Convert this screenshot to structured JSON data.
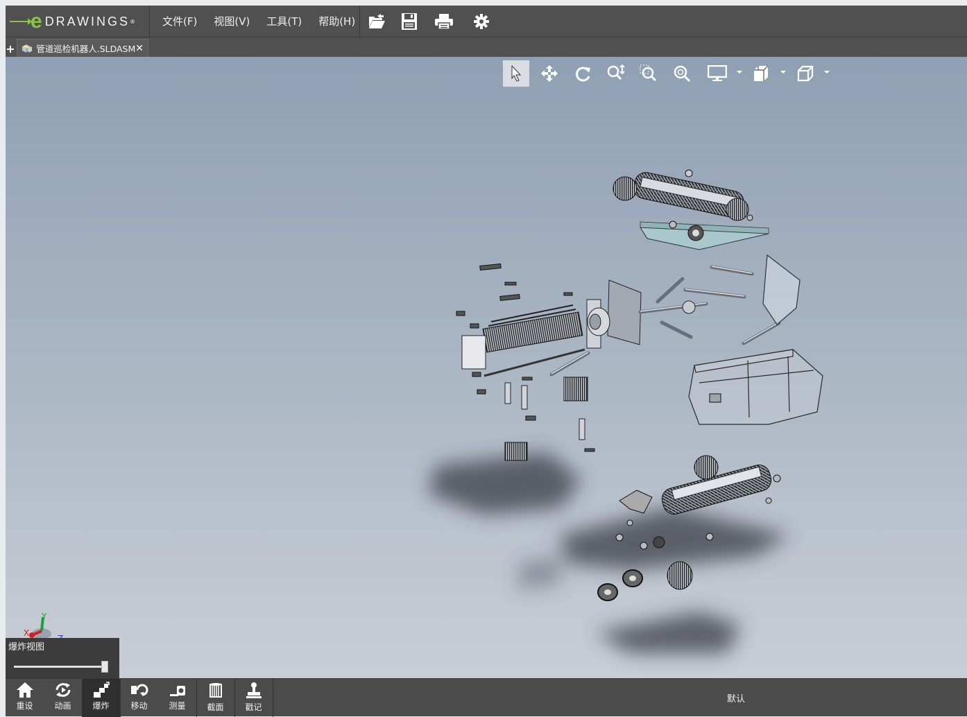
{
  "app": {
    "logo_text": "DRAWINGS",
    "logo_reg": "®"
  },
  "menu": {
    "items": [
      "文件(F)",
      "视图(V)",
      "工具(T)",
      "帮助(H)"
    ]
  },
  "toolbar": {
    "icons": [
      "open-icon",
      "save-icon",
      "print-icon",
      "settings-icon"
    ]
  },
  "tabs": {
    "add_label": "+",
    "documents": [
      {
        "label": "管道巡检机器人.SLDASM",
        "close": "✕"
      }
    ]
  },
  "view_tools": {
    "icons": [
      "select-icon",
      "pan-icon",
      "rotate-icon",
      "zoom-icon",
      "zoom-area-icon",
      "zoom-fit-icon",
      "display-icon",
      "style-icon",
      "view-orient-icon"
    ]
  },
  "triad": {
    "x": "X",
    "y": "Y",
    "z": "Z"
  },
  "explode_panel": {
    "title": "爆炸视图",
    "slider_value": 1.0
  },
  "bottom_toolbar": {
    "buttons": [
      {
        "label": "重设",
        "icon": "home-icon"
      },
      {
        "label": "动画",
        "icon": "animate-icon"
      },
      {
        "label": "爆炸",
        "icon": "explode-icon",
        "active": true
      },
      {
        "label": "移动",
        "icon": "move-icon"
      },
      {
        "label": "测量",
        "icon": "measure-icon"
      },
      {
        "label": "截面",
        "icon": "section-icon"
      },
      {
        "label": "戳记",
        "icon": "stamp-icon"
      }
    ],
    "configuration": "默认"
  },
  "colors": {
    "logo_accent": "#8bc34a",
    "bar_bg": "#505050",
    "viewport_top": "#8fa0b4",
    "viewport_bottom": "#c9ced6"
  }
}
